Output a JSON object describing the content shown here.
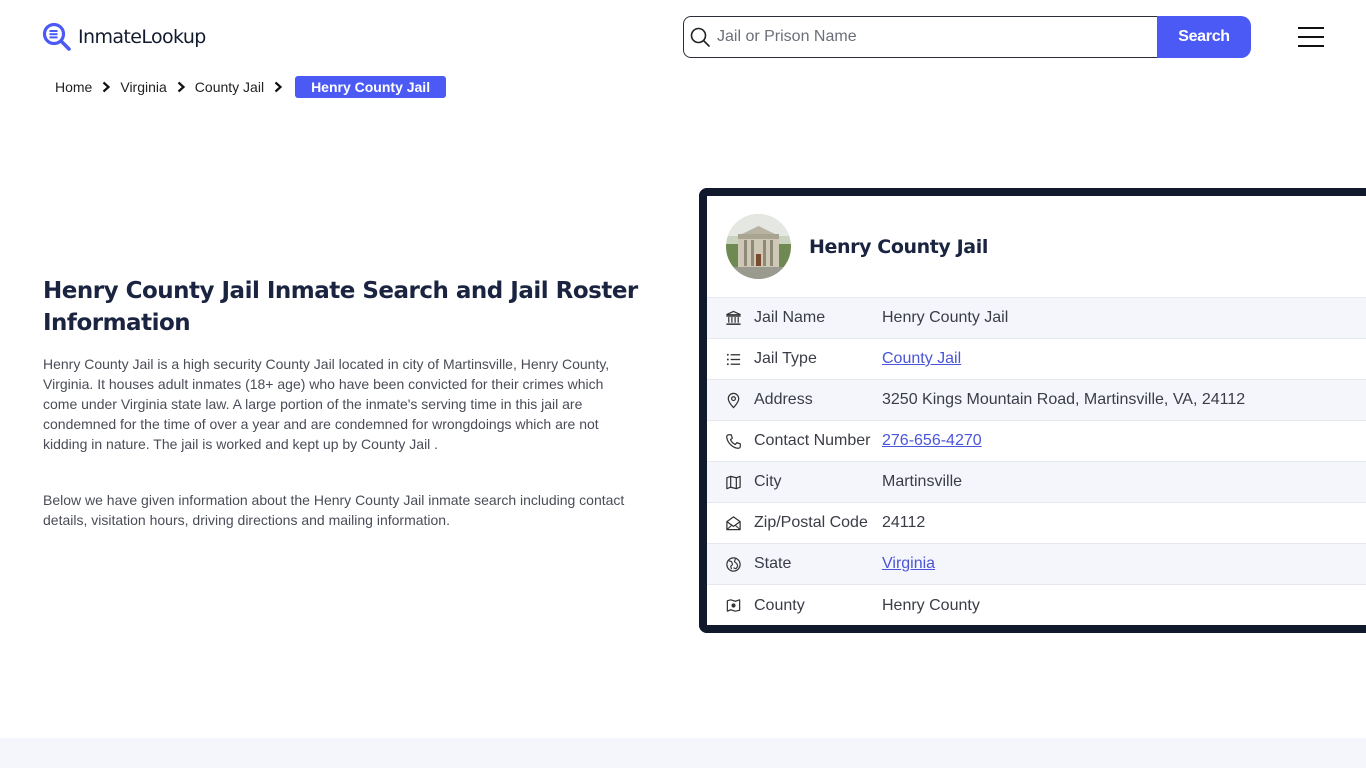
{
  "header": {
    "logo_text": "InmateLookup",
    "search": {
      "placeholder": "Jail or Prison Name",
      "value": "",
      "button_label": "Search"
    },
    "menu_icon": "hamburger-icon"
  },
  "breadcrumb": {
    "items": [
      {
        "label": "Home"
      },
      {
        "label": "Virginia"
      },
      {
        "label": "County Jail"
      }
    ],
    "current": "Henry County Jail"
  },
  "main": {
    "title": "Henry County Jail Inmate Search and Jail Roster Information",
    "paragraphs": [
      "Henry County Jail is a high security County Jail located in city of Martinsville, Henry County, Virginia. It houses adult inmates (18+ age) who have been convicted for their crimes which come under Virginia state law. A large portion of the inmate's serving time in this jail are condemned for the time of over a year and are condemned for wrongdoings which are not kidding in nature. The jail is worked and kept up by County Jail .",
      "Below we have given information about the Henry County Jail inmate search including contact details, visitation hours, driving directions and mailing information."
    ]
  },
  "card": {
    "title": "Henry County Jail",
    "rows": [
      {
        "icon": "building-columns-icon",
        "label": "Jail Name",
        "value": "Henry County Jail",
        "link": false
      },
      {
        "icon": "list-icon",
        "label": "Jail Type",
        "value": "County Jail",
        "link": true
      },
      {
        "icon": "map-pin-icon",
        "label": "Address",
        "value": "3250 Kings Mountain Road, Martinsville, VA, 24112",
        "link": false
      },
      {
        "icon": "phone-icon",
        "label": "Contact Number",
        "value": "276-656-4270",
        "link": true
      },
      {
        "icon": "map-icon",
        "label": "City",
        "value": "Martinsville",
        "link": false
      },
      {
        "icon": "mail-open-icon",
        "label": "Zip/Postal Code",
        "value": "24112",
        "link": false
      },
      {
        "icon": "globe-icon",
        "label": "State",
        "value": "Virginia",
        "link": true
      },
      {
        "icon": "county-map-icon",
        "label": "County",
        "value": "Henry County",
        "link": false
      }
    ]
  },
  "colors": {
    "accent": "#4b5af5",
    "card_border": "#111a2d",
    "link": "#4b55d8",
    "row_alt": "#f5f6fc"
  }
}
